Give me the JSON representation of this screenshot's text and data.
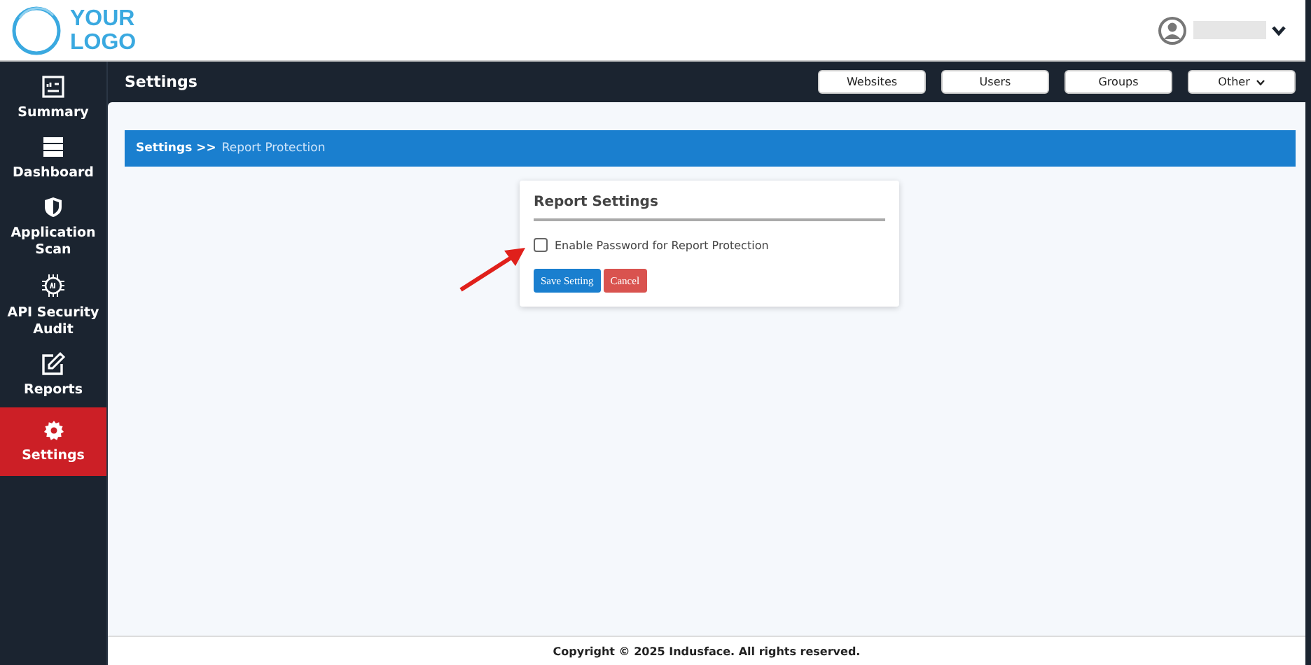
{
  "header": {
    "logo_lines": [
      "YOUR",
      "LOGO"
    ]
  },
  "topbar": {
    "title": "Settings",
    "buttons": [
      {
        "label": "Websites",
        "kind": "plain"
      },
      {
        "label": "Users",
        "kind": "plain"
      },
      {
        "label": "Groups",
        "kind": "plain"
      },
      {
        "label": "Other",
        "kind": "dropdown"
      }
    ]
  },
  "sidebar": {
    "items": [
      {
        "label": "Summary",
        "selected": false
      },
      {
        "label": "Dashboard",
        "selected": false
      },
      {
        "label": "Application Scan",
        "selected": false
      },
      {
        "label": "API Security Audit",
        "selected": false
      },
      {
        "label": "Reports",
        "selected": false
      },
      {
        "label": "Settings",
        "selected": true
      }
    ]
  },
  "breadcrumb": {
    "parent": "Settings >>",
    "current": "Report Protection"
  },
  "card": {
    "title": "Report Settings",
    "checkbox": {
      "label": "Enable Password for Report Protection",
      "checked": false
    },
    "buttons": [
      {
        "label": "Save Setting",
        "kind": "primary"
      },
      {
        "label": "Cancel",
        "kind": "danger"
      }
    ]
  },
  "footer": {
    "text": "Copyright © 2025 Indusface. All rights reserved."
  }
}
